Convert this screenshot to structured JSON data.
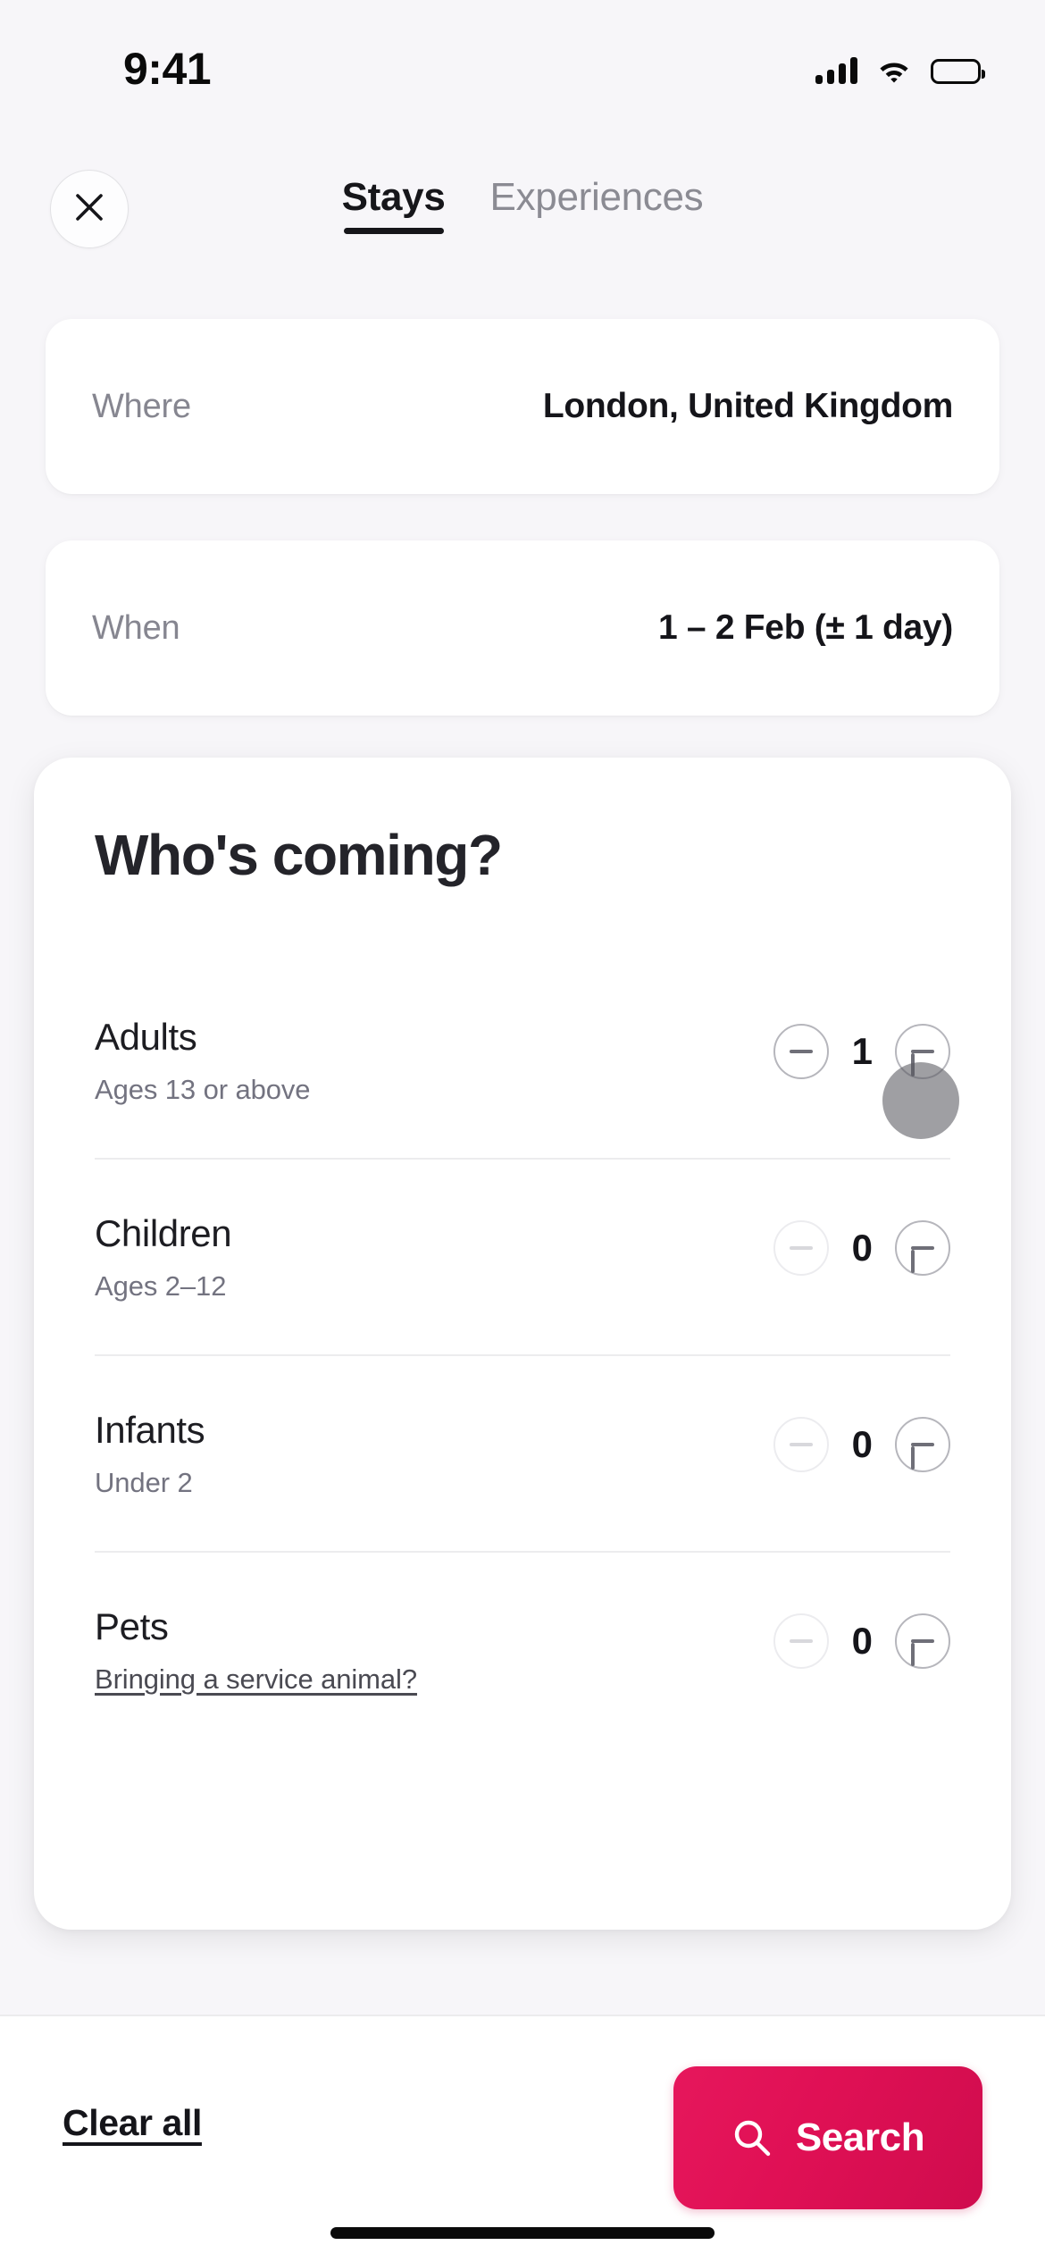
{
  "status_bar": {
    "time": "9:41",
    "signal_icon": "cellular-bars-icon",
    "wifi_icon": "wifi-icon",
    "battery_icon": "battery-full-icon"
  },
  "header": {
    "close_icon": "close-icon",
    "tabs": [
      {
        "label": "Stays",
        "active": true
      },
      {
        "label": "Experiences",
        "active": false
      }
    ]
  },
  "fields": [
    {
      "label": "Where",
      "value": "London, United Kingdom"
    },
    {
      "label": "When",
      "value": "1 – 2 Feb (± 1 day)"
    }
  ],
  "guests_panel": {
    "title": "Who's coming?",
    "rows": [
      {
        "name": "Adults",
        "subtitle": "Ages 13 or above",
        "subtitle_is_link": false,
        "count": "1",
        "decrement_enabled": true,
        "increment_enabled": true,
        "decrement_icon": "minus-icon",
        "increment_icon": "plus-icon"
      },
      {
        "name": "Children",
        "subtitle": "Ages 2–12",
        "subtitle_is_link": false,
        "count": "0",
        "decrement_enabled": false,
        "increment_enabled": true,
        "decrement_icon": "minus-icon",
        "increment_icon": "plus-icon"
      },
      {
        "name": "Infants",
        "subtitle": "Under 2",
        "subtitle_is_link": false,
        "count": "0",
        "decrement_enabled": false,
        "increment_enabled": true,
        "decrement_icon": "minus-icon",
        "increment_icon": "plus-icon"
      },
      {
        "name": "Pets",
        "subtitle": "Bringing a service animal?",
        "subtitle_is_link": true,
        "count": "0",
        "decrement_enabled": false,
        "increment_enabled": true,
        "decrement_icon": "minus-icon",
        "increment_icon": "plus-icon"
      }
    ]
  },
  "tap_indicator": {
    "target": "adults-increment-button"
  },
  "bottom_bar": {
    "clear_all_label": "Clear all",
    "search_label": "Search",
    "search_icon": "search-icon"
  },
  "colors": {
    "accent": "#e0105 5",
    "accent_start": "#e6175c",
    "accent_end": "#cf0c4d",
    "page_background": "#f7f6f9",
    "card_background": "#ffffff",
    "text_primary": "#15151a",
    "text_secondary": "#737380"
  }
}
